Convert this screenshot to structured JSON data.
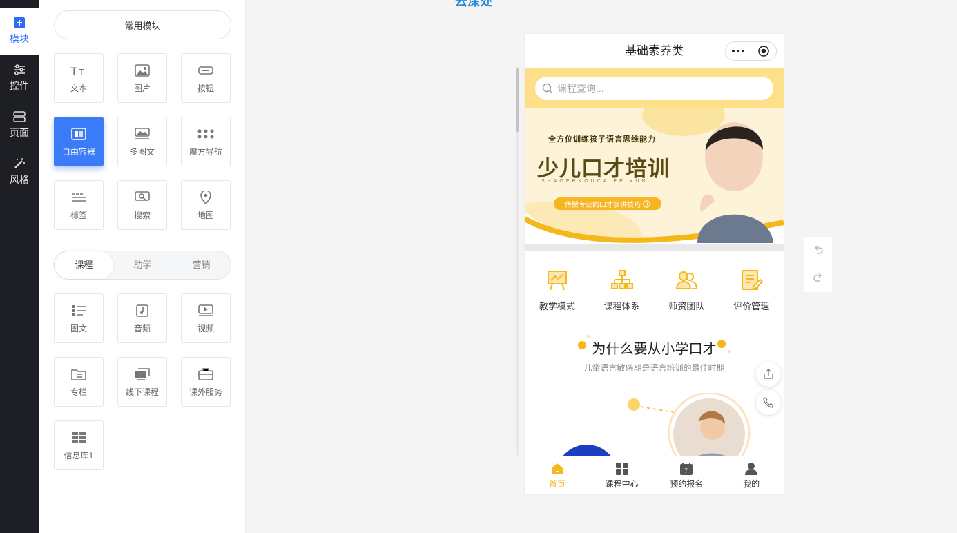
{
  "logo_text": "云深处",
  "rail": [
    {
      "label": "模块",
      "icon": "plus-square-icon",
      "active": true
    },
    {
      "label": "控件",
      "icon": "sliders-icon"
    },
    {
      "label": "页面",
      "icon": "server-icon"
    },
    {
      "label": "风格",
      "icon": "magic-wand-icon"
    }
  ],
  "panel": {
    "common_title": "常用模块",
    "common": [
      {
        "label": "文本",
        "icon": "text-icon"
      },
      {
        "label": "图片",
        "icon": "image-icon"
      },
      {
        "label": "按钮",
        "icon": "button-icon"
      },
      {
        "label": "自由容器",
        "icon": "container-icon",
        "active": true
      },
      {
        "label": "多图文",
        "icon": "multi-image-text-icon"
      },
      {
        "label": "魔方导航",
        "icon": "cube-nav-icon"
      },
      {
        "label": "标签",
        "icon": "tag-icon"
      },
      {
        "label": "搜索",
        "icon": "search-icon"
      },
      {
        "label": "地图",
        "icon": "map-pin-icon"
      }
    ],
    "tabs": [
      "课程",
      "助学",
      "营销"
    ],
    "course": [
      {
        "label": "图文",
        "icon": "image-text-icon"
      },
      {
        "label": "音频",
        "icon": "audio-icon"
      },
      {
        "label": "视频",
        "icon": "video-icon"
      },
      {
        "label": "专栏",
        "icon": "column-icon"
      },
      {
        "label": "线下课程",
        "icon": "offline-course-icon"
      },
      {
        "label": "课外服务",
        "icon": "service-icon"
      },
      {
        "label": "信息库1",
        "icon": "grid-icon"
      }
    ]
  },
  "phone": {
    "title": "基础素养类",
    "search_placeholder": "课程查询...",
    "banner": {
      "tagline": "全方位训练孩子语言思维能力",
      "headline": "少儿口才培训",
      "pinyin": "SHAOERKOUCAIPEIXUN",
      "cta": "传授专业的口才演讲技巧"
    },
    "features": [
      {
        "label": "教学模式",
        "icon": "teaching-board-icon"
      },
      {
        "label": "课程体系",
        "icon": "hierarchy-icon"
      },
      {
        "label": "师资团队",
        "icon": "team-icon"
      },
      {
        "label": "评价管理",
        "icon": "evaluation-icon"
      }
    ],
    "why_title": "为什么要从小学口才",
    "why_sub": "儿童语言敏感期是语言培训的最佳时期",
    "tabbar": [
      {
        "label": "首页",
        "icon": "home-icon",
        "active": true
      },
      {
        "label": "课程中心",
        "icon": "grid-icon"
      },
      {
        "label": "预约报名",
        "icon": "calendar-icon"
      },
      {
        "label": "我的",
        "icon": "user-icon"
      }
    ]
  },
  "colors": {
    "accent": "#3b7bf7",
    "theme": "#f5b81b",
    "band": "#ffe08a"
  }
}
